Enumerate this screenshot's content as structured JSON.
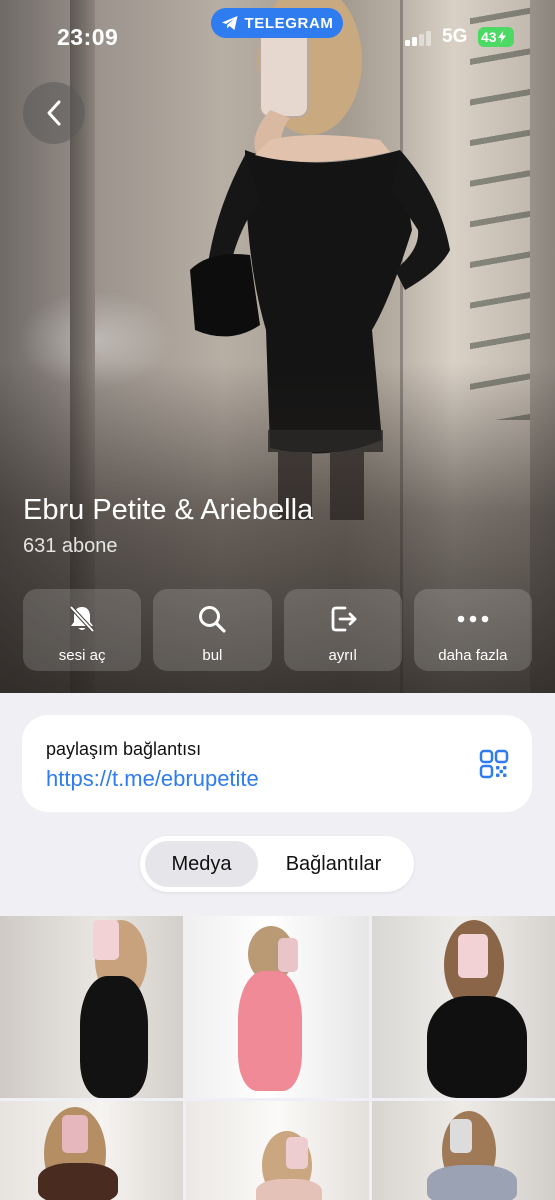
{
  "status_bar": {
    "time": "23:09",
    "app_pill": "TELEGRAM",
    "network": "5G",
    "battery": "43"
  },
  "channel": {
    "title": "Ebru Petite & Ariebella",
    "subscribers": "631 abone"
  },
  "actions": [
    {
      "label": "sesi aç",
      "icon": "bell-slash-icon"
    },
    {
      "label": "bul",
      "icon": "search-icon"
    },
    {
      "label": "ayrıl",
      "icon": "leave-icon"
    },
    {
      "label": "daha fazla",
      "icon": "more-dots-icon"
    }
  ],
  "share_link": {
    "label": "paylaşım bağlantısı",
    "url": "https://t.me/ebrupetite",
    "icon": "qr-code-icon"
  },
  "tabs": {
    "media": "Medya",
    "links": "Bağlantılar",
    "selected": "Medya"
  },
  "colors": {
    "accent": "#2f7cf0",
    "battery": "#4cd964",
    "background": "#efeff4"
  }
}
